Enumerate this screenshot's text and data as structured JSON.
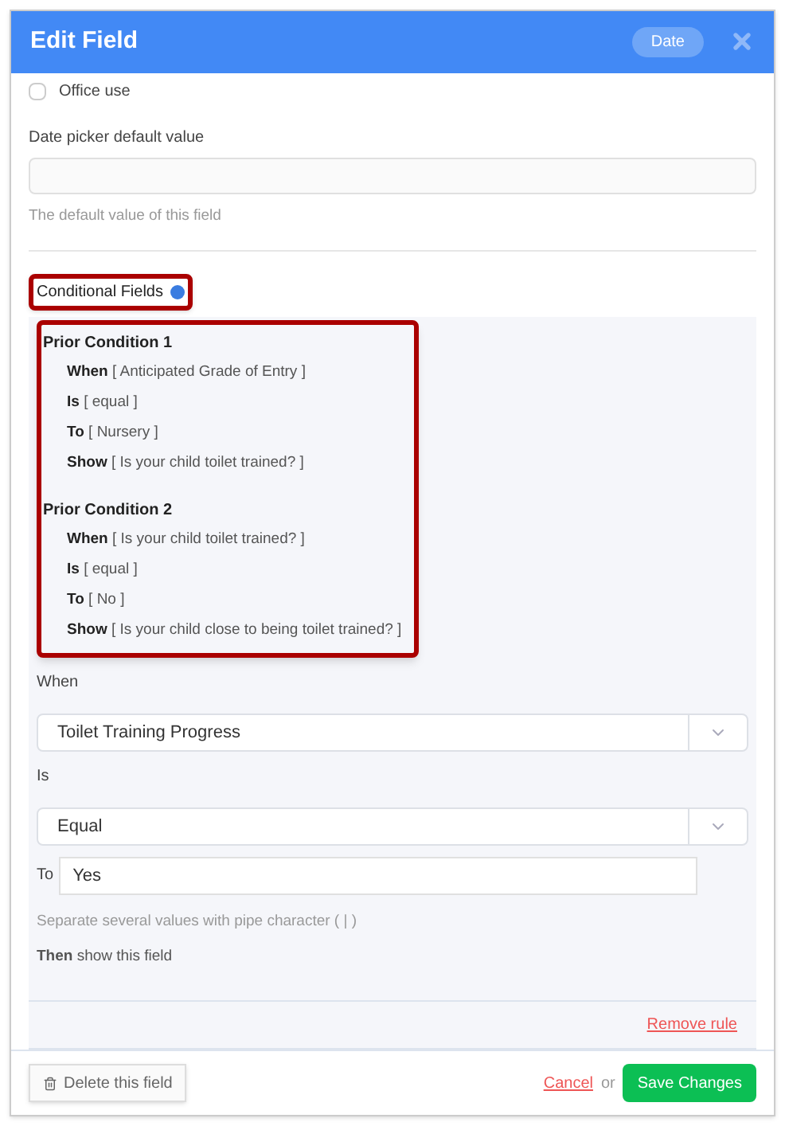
{
  "dialog": {
    "title": "Edit Field",
    "type_badge": "Date"
  },
  "office_use": {
    "label": "Office use",
    "checked": false
  },
  "default_value": {
    "label": "Date picker default value",
    "help": "The default value of this field"
  },
  "conditional": {
    "label": "Conditional Fields",
    "prior_conditions": [
      {
        "title": "Prior Condition 1",
        "lines": [
          {
            "key": "When",
            "value": "[ Anticipated Grade of Entry ]"
          },
          {
            "key": "Is",
            "value": "[ equal ]"
          },
          {
            "key": "To",
            "value": "[ Nursery ]"
          },
          {
            "key": "Show",
            "value": "[ Is your child toilet trained? ]"
          }
        ]
      },
      {
        "title": "Prior Condition 2",
        "lines": [
          {
            "key": "When",
            "value": "[ Is your child toilet trained? ]"
          },
          {
            "key": "Is",
            "value": "[ equal ]"
          },
          {
            "key": "To",
            "value": "[ No ]"
          },
          {
            "key": "Show",
            "value": "[ Is your child close to being toilet trained? ]"
          }
        ]
      }
    ],
    "when_label": "When",
    "when_value": "Toilet Training Progress",
    "is_label": "Is",
    "is_value": "Equal",
    "to_label": "To",
    "to_value": "Yes",
    "hint": "Separate several values with pipe character ( | )",
    "then": "**Then** show this field",
    "remove": "Remove rule"
  },
  "footer": {
    "delete": "Delete this field",
    "cancel": "Cancel",
    "or": "or",
    "save": "Save Changes"
  }
}
